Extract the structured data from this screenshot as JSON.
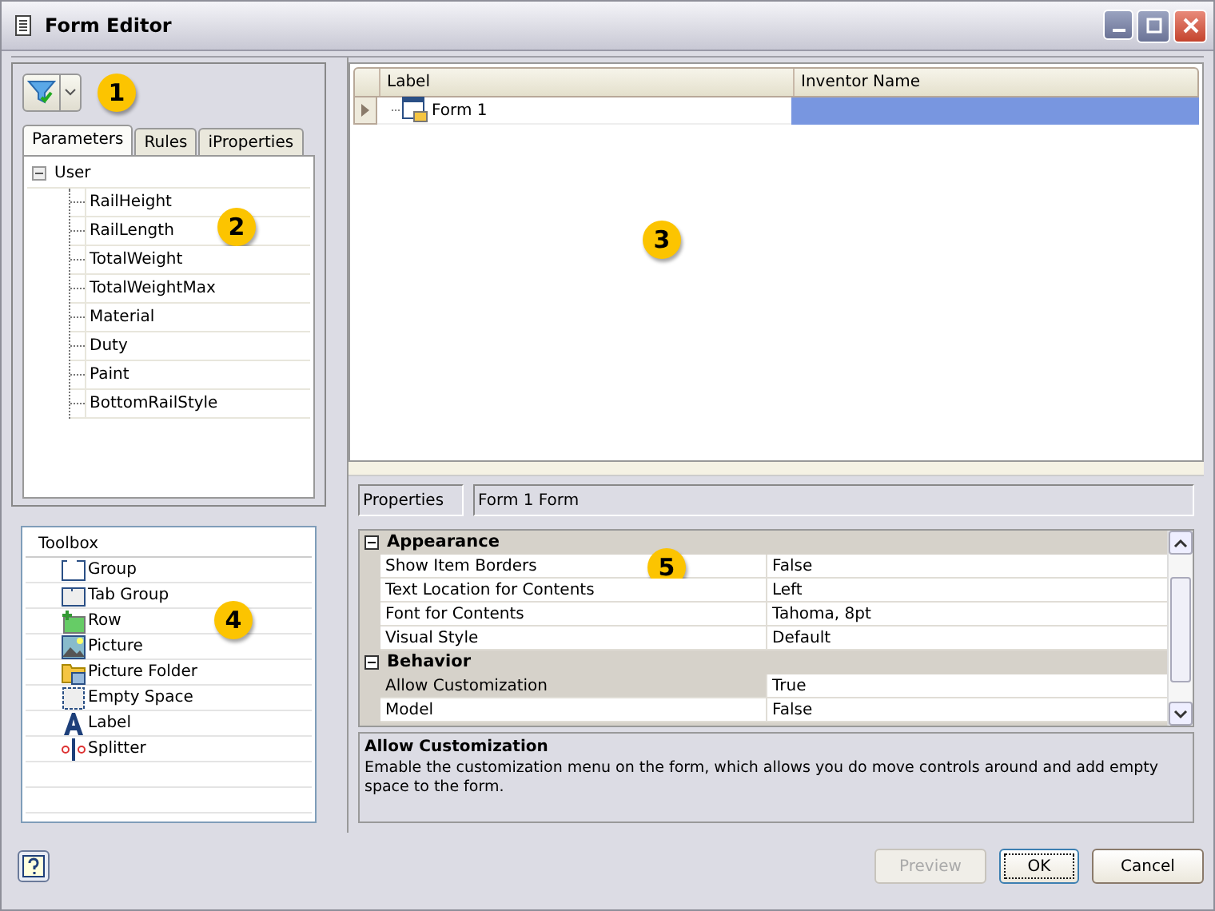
{
  "window": {
    "title": "Form Editor"
  },
  "callouts": [
    "1",
    "2",
    "3",
    "4",
    "5"
  ],
  "tabs": [
    {
      "label": "Parameters",
      "selected": true
    },
    {
      "label": "Rules",
      "selected": false
    },
    {
      "label": "iProperties",
      "selected": false
    }
  ],
  "parameter_tree": [
    {
      "label": "User",
      "expanded": true,
      "children": [
        {
          "label": "RailHeight"
        },
        {
          "label": "RailLength"
        },
        {
          "label": "TotalWeight"
        },
        {
          "label": "TotalWeightMax"
        },
        {
          "label": "Material"
        },
        {
          "label": "Duty"
        },
        {
          "label": "Paint"
        },
        {
          "label": "BottomRailStyle"
        }
      ]
    }
  ],
  "toolbox": {
    "header": "Toolbox",
    "items": [
      {
        "label": "Group",
        "kind": "group"
      },
      {
        "label": "Tab Group",
        "kind": "tabgroup"
      },
      {
        "label": "Row",
        "kind": "row"
      },
      {
        "label": "Picture",
        "kind": "picture"
      },
      {
        "label": "Picture Folder",
        "kind": "folder"
      },
      {
        "label": "Empty Space",
        "kind": "space"
      },
      {
        "label": "Label",
        "kind": "label"
      },
      {
        "label": "Splitter",
        "kind": "splitter"
      }
    ]
  },
  "form_grid": {
    "columns": [
      "Label",
      "Inventor Name"
    ],
    "rows": [
      {
        "label": "Form 1",
        "inventor_name_selected": true
      }
    ]
  },
  "properties": {
    "label": "Properties",
    "object": "Form 1 Form",
    "categories": [
      {
        "name": "Appearance",
        "expanded": true,
        "rows": [
          {
            "name": "Show Item Borders",
            "value": "False",
            "selected": false
          },
          {
            "name": "Text Location for Contents",
            "value": "Left",
            "selected": false
          },
          {
            "name": "Font for Contents",
            "value": "Tahoma, 8pt",
            "selected": false
          },
          {
            "name": "Visual Style",
            "value": "Default",
            "selected": false
          }
        ]
      },
      {
        "name": "Behavior",
        "expanded": true,
        "rows": [
          {
            "name": "Allow Customization",
            "value": "True",
            "selected": true
          },
          {
            "name": "Model",
            "value": "False",
            "selected": false
          }
        ]
      }
    ],
    "description_title": "Allow Customization",
    "description": "Emable the customization menu on the form, which allows you do move controls around and add empty space to the form."
  },
  "buttons": [
    {
      "label": "Preview",
      "disabled": true,
      "default": false
    },
    {
      "label": "OK",
      "disabled": false,
      "default": true
    },
    {
      "label": "Cancel",
      "disabled": false,
      "default": false
    }
  ]
}
